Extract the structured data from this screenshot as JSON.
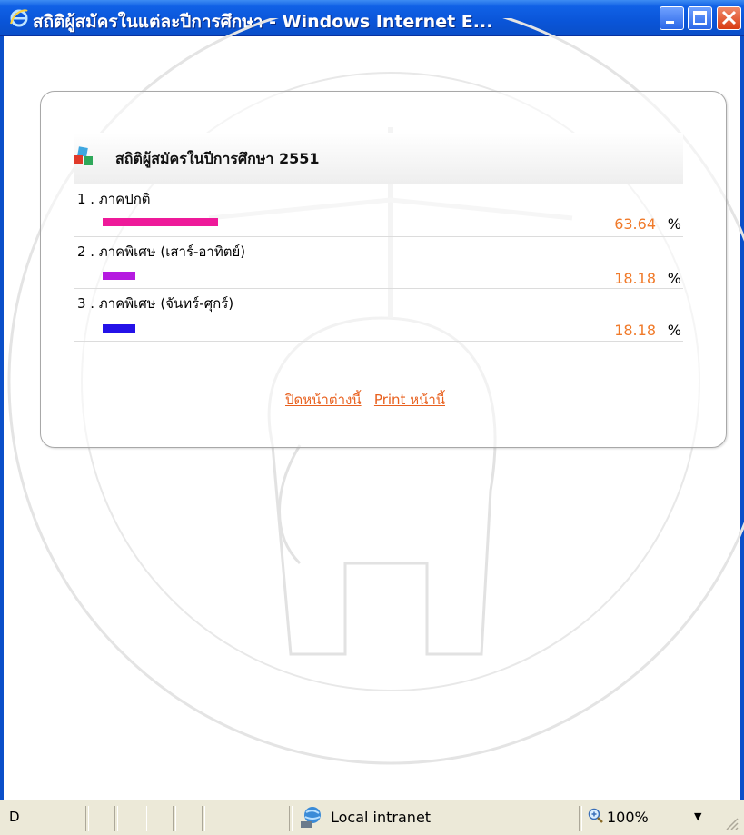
{
  "window": {
    "title": "สถิติผู้สมัครในแต่ละปีการศึกษา - Windows Internet E..."
  },
  "panel": {
    "title": "สถิติผู้สมัครในปีการศึกษา 2551",
    "rows": [
      {
        "label": "1 . ภาคปกติ",
        "percent": "63.64",
        "value": 63.64,
        "unit": "%",
        "color": "#ee1a9a"
      },
      {
        "label": "2 . ภาคพิเศษ (เสาร์-อาทิตย์)",
        "percent": "18.18",
        "value": 18.18,
        "unit": "%",
        "color": "#b51ae0"
      },
      {
        "label": "3 . ภาคพิเศษ (จันทร์-ศุกร์)",
        "percent": "18.18",
        "value": 18.18,
        "unit": "%",
        "color": "#2412e8"
      }
    ],
    "links": {
      "close_window": "ปิดหน้าต่างนี้",
      "print_page": "Print หน้านี้"
    }
  },
  "statusbar": {
    "left_text": "D",
    "zone": "Local intranet",
    "zoom": "100%"
  },
  "colors": {
    "titlebar": "#0a55d8",
    "percent_text": "#f07a2a",
    "link": "#e8601e"
  }
}
